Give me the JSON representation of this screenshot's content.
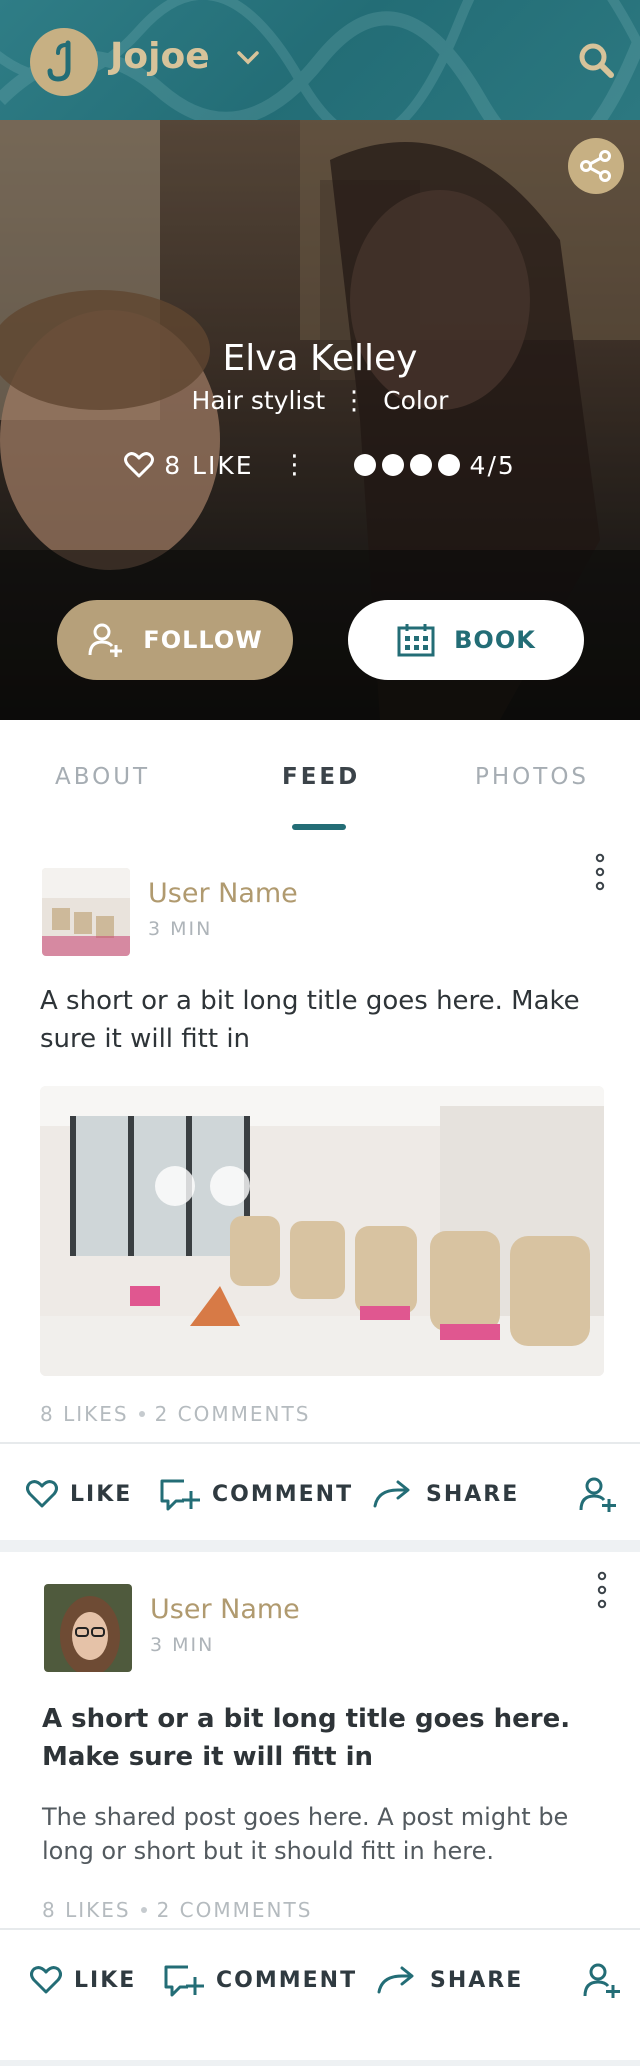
{
  "header": {
    "brand": "Jojoe",
    "logo_letter": "J",
    "icons": {
      "menu_chevron": "chevron-down-icon",
      "search": "search-icon"
    }
  },
  "profile": {
    "name": "Elva Kelley",
    "role": "Hair stylist",
    "specialty": "Color",
    "likes_label": "8 LIKE",
    "rating_label": "4/5",
    "rating_value": 4,
    "rating_max": 5,
    "follow_label": "FOLLOW",
    "book_label": "BOOK"
  },
  "tabs": [
    {
      "label": "ABOUT",
      "active": false
    },
    {
      "label": "FEED",
      "active": true
    },
    {
      "label": "PHOTOS",
      "active": false
    }
  ],
  "posts": [
    {
      "user": "User Name",
      "time": "3 MIN",
      "title": "A short or a bit long title goes here. Make sure it will fitt in",
      "text": "",
      "likes": "8 LIKES",
      "comments": "2 COMMENTS"
    },
    {
      "user": "User Name",
      "time": "3 MIN",
      "title": "A short or a bit long title goes here. Make sure it will fitt in",
      "text": "The shared post goes here. A post might be long or short but it should fitt in here.",
      "likes": "8 LIKES",
      "comments": "2 COMMENTS"
    }
  ],
  "actions": {
    "like": "LIKE",
    "comment": "COMMENT",
    "share": "SHARE"
  },
  "colors": {
    "teal": "#236d76",
    "gold": "#b6a07a",
    "text": "#2d3338"
  }
}
